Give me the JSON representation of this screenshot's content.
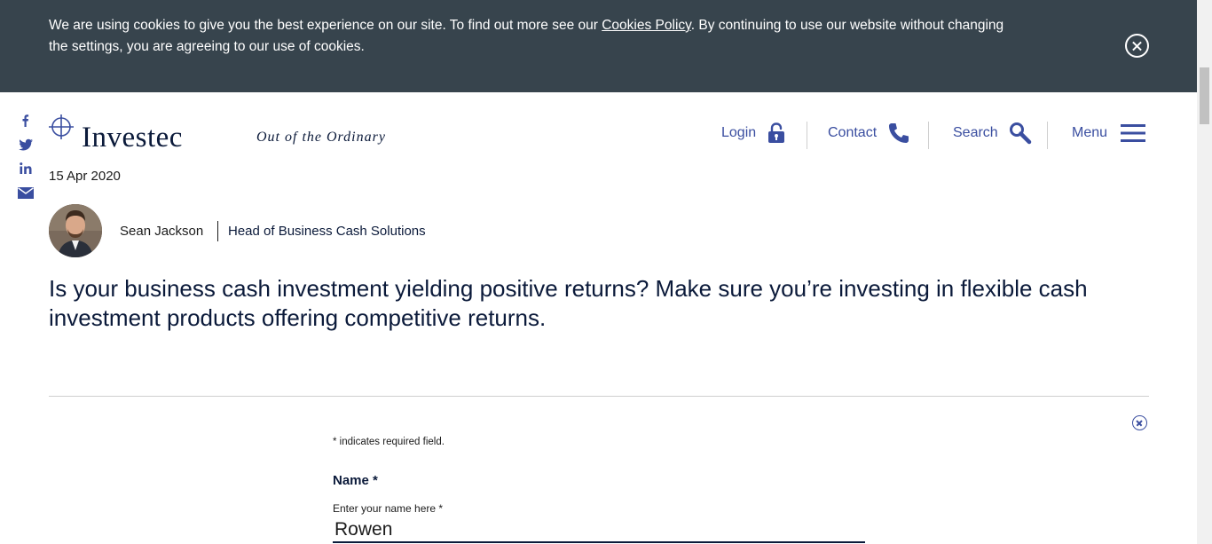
{
  "cookie_banner": {
    "text_before_link": "We are using cookies to give you the best experience on our site. To find out more see our ",
    "link_text": "Cookies Policy",
    "text_after_link": ". By continuing to use our website without changing the settings, you are agreeing to our use of cookies.",
    "close_icon": "close-circle-icon"
  },
  "social": {
    "icons": [
      "facebook-icon",
      "twitter-icon",
      "linkedin-icon",
      "email-icon"
    ]
  },
  "header": {
    "logo_text": "Investec",
    "tagline": "Out of the Ordinary",
    "nav": {
      "login": "Login",
      "contact": "Contact",
      "search": "Search",
      "menu": "Menu"
    },
    "accent_color": "#3a4ea0"
  },
  "article": {
    "date": "15 Apr 2020",
    "author_name": "Sean Jackson",
    "author_role": "Head of Business Cash Solutions",
    "lede": "Is your business cash investment yielding positive returns? Make sure you’re investing in flexible cash investment products offering competitive returns."
  },
  "form": {
    "required_note": "* indicates required field.",
    "name_title": "Name *",
    "name_label": "Enter your name here *",
    "name_value": "Rowen"
  },
  "colors": {
    "banner_bg": "#37444d",
    "navy": "#0b1a3a"
  }
}
